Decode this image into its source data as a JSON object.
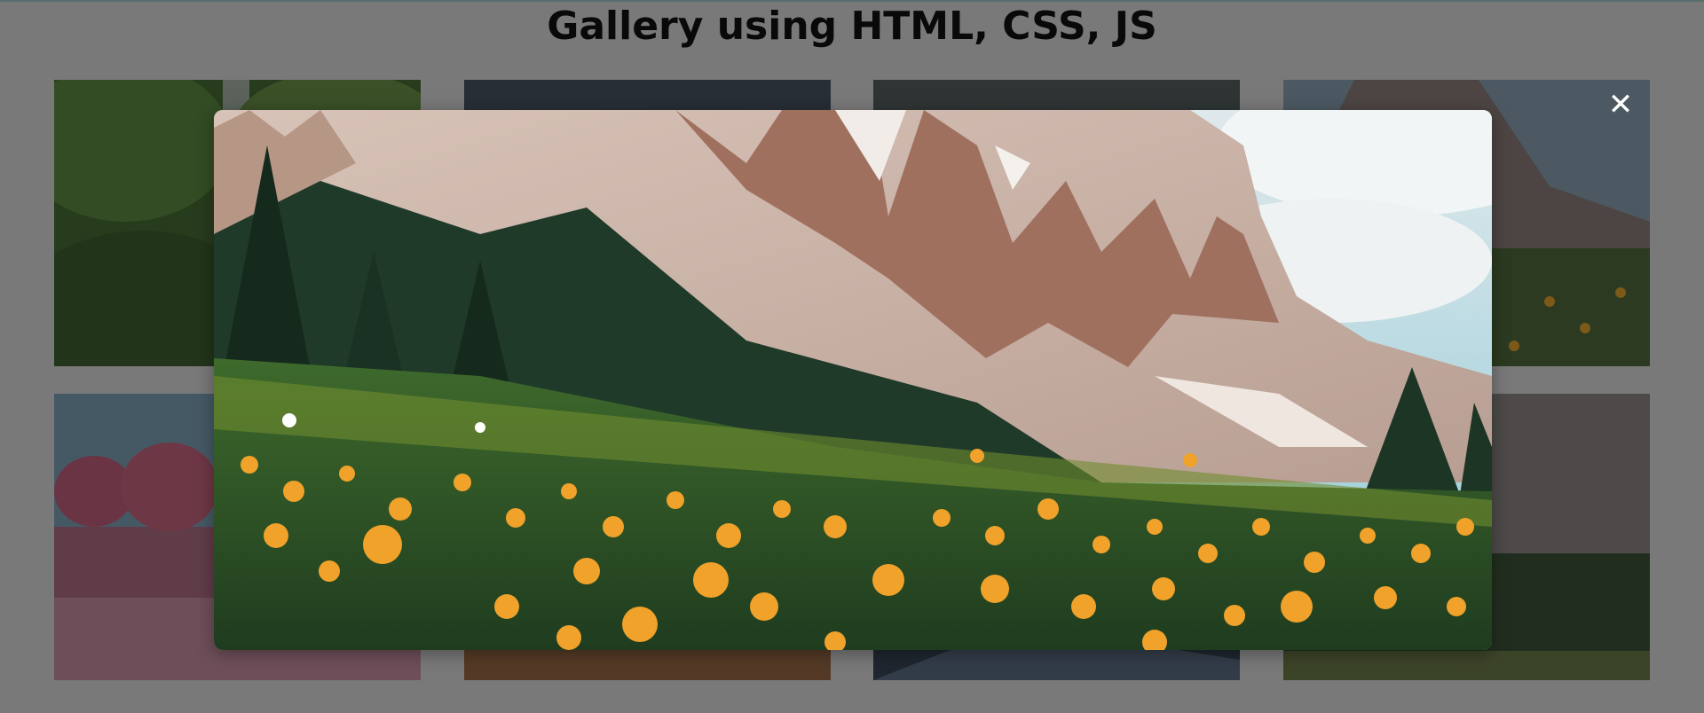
{
  "page": {
    "title": "Gallery using HTML, CSS, JS"
  },
  "gallery": {
    "tiles": [
      {
        "name": "waterfall-forest",
        "colors": {
          "base": "#4f7a3a",
          "accent": "#7aa45a"
        }
      },
      {
        "name": "dark-mountain-lake",
        "colors": {
          "base": "#5a6470",
          "accent": "#3f4753"
        }
      },
      {
        "name": "foggy-forest",
        "colors": {
          "base": "#4f5a5c",
          "accent": "#363e40"
        }
      },
      {
        "name": "mountain-meadow-small",
        "colors": {
          "base": "#8e8582",
          "accent": "#52703e"
        }
      },
      {
        "name": "pink-blossom-trees",
        "colors": {
          "base": "#c07a8c",
          "accent": "#7da0b8"
        }
      },
      {
        "name": "desert-sunset",
        "colors": {
          "base": "#c08a5e",
          "accent": "#8a5a3a"
        }
      },
      {
        "name": "city-road-night",
        "colors": {
          "base": "#3a4656",
          "accent": "#586a80"
        }
      },
      {
        "name": "granite-cliff-forest",
        "colors": {
          "base": "#8a8a8a",
          "accent": "#3f5a3c"
        }
      }
    ]
  },
  "lightbox": {
    "image_name": "alpine-flower-meadow",
    "close_symbol": "✕"
  },
  "colors": {
    "background": "#dcdcdc",
    "overlay": "rgba(0,0,0,0.45)"
  }
}
